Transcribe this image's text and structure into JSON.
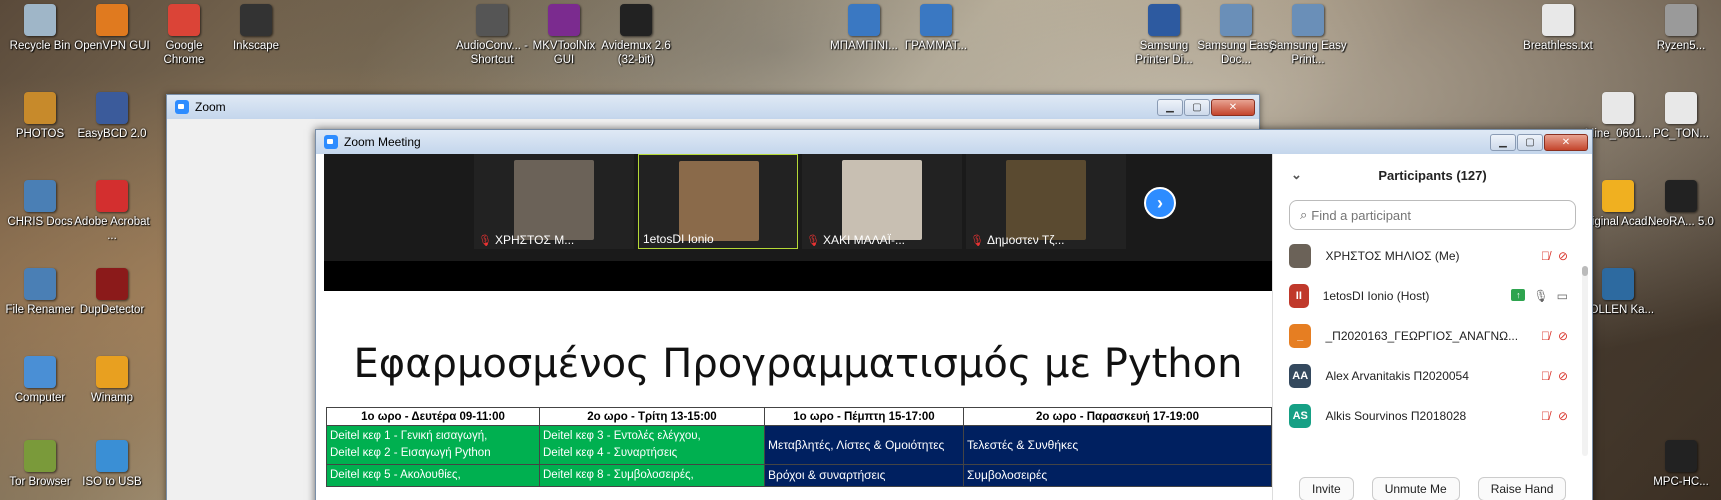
{
  "desktop": {
    "icons": [
      {
        "label": "Recycle Bin",
        "icon": "recycle-bin-icon",
        "color": "#9fb6c8"
      },
      {
        "label": "OpenVPN GUI",
        "icon": "openvpn-icon",
        "color": "#e07a1f"
      },
      {
        "label": "Google Chrome",
        "icon": "chrome-icon",
        "color": "#db4437"
      },
      {
        "label": "Inkscape",
        "icon": "inkscape-icon",
        "color": "#333333"
      },
      {
        "label": "AudioConv... - Shortcut",
        "icon": "audio-converter-icon",
        "color": "#555555"
      },
      {
        "label": "MKVToolNix GUI",
        "icon": "mkvtoolnix-icon",
        "color": "#7b2b8f"
      },
      {
        "label": "Avidemux 2.6 (32-bit)",
        "icon": "avidemux-icon",
        "color": "#222222"
      },
      {
        "label": "ΜΠΑΜΠΙΝΙ...",
        "icon": "document-shortcut-icon",
        "color": "#3a78c2"
      },
      {
        "label": "ΓΡΑΜΜΑΤ...",
        "icon": "document-shortcut-icon",
        "color": "#3a78c2"
      },
      {
        "label": "Samsung Printer Di...",
        "icon": "printer-icon",
        "color": "#2d5aa0"
      },
      {
        "label": "Samsung Easy Doc...",
        "icon": "printer-icon",
        "color": "#6a8fb8"
      },
      {
        "label": "Samsung Easy Print...",
        "icon": "printer-icon",
        "color": "#6a8fb8"
      },
      {
        "label": "Breathless.txt",
        "icon": "text-file-icon",
        "color": "#e8e8e8"
      },
      {
        "label": "Ryzen5...",
        "icon": "file-icon",
        "color": "#9a9a9a"
      },
      {
        "label": "PHOTOS",
        "icon": "folder-icon",
        "color": "#c78a2b"
      },
      {
        "label": "EasyBCD 2.0",
        "icon": "easybcd-icon",
        "color": "#3b5b9b"
      },
      {
        "label": "CHRIS Docs",
        "icon": "folder-icon",
        "color": "#4a7fb5"
      },
      {
        "label": "Adobe Acrobat ...",
        "icon": "acrobat-icon",
        "color": "#d32f2f"
      },
      {
        "label": "File Renamer",
        "icon": "file-renamer-icon",
        "color": "#4a7fb5"
      },
      {
        "label": "DupDetector",
        "icon": "dupdetector-icon",
        "color": "#8b1a1a"
      },
      {
        "label": "Computer",
        "icon": "computer-icon",
        "color": "#4a8fd5"
      },
      {
        "label": "Winamp",
        "icon": "winamp-icon",
        "color": "#e8a020"
      },
      {
        "label": "Tor Browser",
        "icon": "tor-icon",
        "color": "#7a9a3a"
      },
      {
        "label": "ISO to USB",
        "icon": "iso-usb-icon",
        "color": "#3a8fd5"
      },
      {
        "label": "Mine_0601...",
        "icon": "file-icon",
        "color": "#e8e8e8"
      },
      {
        "label": "PC_TON...",
        "icon": "file-icon",
        "color": "#e8e8e8"
      },
      {
        "label": "Original Acad...",
        "icon": "shortcut-icon",
        "color": "#f0b020"
      },
      {
        "label": "NeoRA... 5.0",
        "icon": "shortcut-icon",
        "color": "#222222"
      },
      {
        "label": "POLLEN Ka...",
        "icon": "shortcut-icon",
        "color": "#2d6aa0"
      },
      {
        "label": "MPC-HC...",
        "icon": "mpc-icon",
        "color": "#222222"
      }
    ]
  },
  "zoom_window": {
    "title": "Zoom"
  },
  "meeting_window": {
    "title": "Zoom Meeting"
  },
  "video_tiles": [
    {
      "name": "ΧΡΗΣΤΟΣ Μ...",
      "muted": true,
      "active": false,
      "color": "#6b6258"
    },
    {
      "name": "1etosDI Ionio",
      "muted": false,
      "active": true,
      "color": "#8a6a4a"
    },
    {
      "name": "ΧΑΚΙ ΜΑΛΑΪ-...",
      "muted": true,
      "active": false,
      "color": "#c8bfb2"
    },
    {
      "name": "Δημοστεν Τζ...",
      "muted": true,
      "active": false,
      "color": "#5a4a30"
    }
  ],
  "slide": {
    "title": "Εφαρμοσμένος Προγραμματισμός με Python",
    "headers": [
      "1ο ωρο - Δευτέρα 09-11:00",
      "2ο ωρο - Τρίτη 13-15:00",
      "1ο ωρο - Πέμπτη 15-17:00",
      "2ο ωρο - Παρασκευή 17-19:00"
    ],
    "rows": [
      [
        "Deitel κεφ 1 - Γενική εισαγωγή,",
        "Deitel κεφ 3 - Εντολές ελέγχου,",
        "Μεταβλητές, Λίστες & Ομοιότητες",
        "Τελεστές & Συνθήκες"
      ],
      [
        "Deitel κεφ 2 - Εισαγωγή Python",
        "Deitel κεφ 4 - Συναρτήσεις",
        "",
        ""
      ],
      [
        "Deitel κεφ 5 - Ακολουθίες,",
        "Deitel κεφ 8 - Συμβολοσειρές,",
        "Βρόχοι & συναρτήσεις",
        "Συμβολοσειρές"
      ]
    ]
  },
  "participants": {
    "title": "Participants (127)",
    "search_placeholder": "Find a participant",
    "list": [
      {
        "name": "ΧΡΗΣΤΟΣ ΜΗΛΙΟΣ (Me)",
        "initials": "",
        "color": "#6b6258",
        "muted": true,
        "video_off": true,
        "sharing": false
      },
      {
        "name": "1etosDI Ionio (Host)",
        "initials": "II",
        "color": "#c0392b",
        "muted": false,
        "video_off": false,
        "sharing": true
      },
      {
        "name": "_Π2020163_ΓΕΩΡΓΙΟΣ_ΑΝΑΓΝΩ...",
        "initials": "_",
        "color": "#e67e22",
        "muted": true,
        "video_off": true,
        "sharing": false
      },
      {
        "name": "Alex Arvanitakis Π2020054",
        "initials": "AA",
        "color": "#34495e",
        "muted": true,
        "video_off": true,
        "sharing": false
      },
      {
        "name": "Alkis Sourvinos Π2018028",
        "initials": "AS",
        "color": "#16a085",
        "muted": true,
        "video_off": true,
        "sharing": false
      }
    ],
    "buttons": {
      "invite": "Invite",
      "unmute_me": "Unmute Me",
      "raise_hand": "Raise Hand"
    }
  },
  "colors": {
    "zoom_blue": "#2d8cff",
    "table_green": "#00b050",
    "table_navy": "#002060"
  }
}
